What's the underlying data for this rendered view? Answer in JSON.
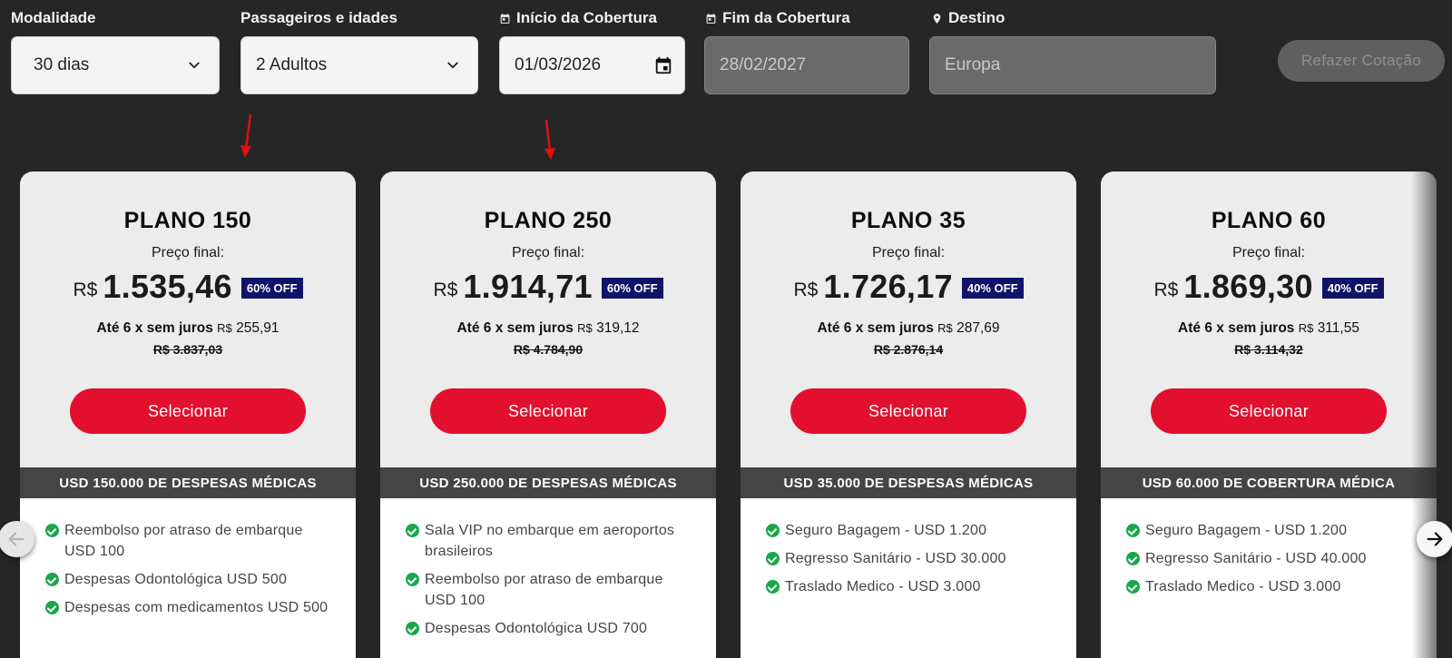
{
  "filters": {
    "modalidade": {
      "label": "Modalidade",
      "value": "30 dias"
    },
    "passageiros": {
      "label": "Passageiros e idades",
      "value": "2 Adultos"
    },
    "inicio": {
      "label": "Início da Cobertura",
      "value": "01/03/2026"
    },
    "fim": {
      "label": "Fim da Cobertura",
      "value": "28/02/2027"
    },
    "destino": {
      "label": "Destino",
      "value": "Europa"
    },
    "requote_label": "Refazer Cotação"
  },
  "plans": [
    {
      "title": "PLANO 150",
      "price_label": "Preço final:",
      "currency": "R$",
      "amount": "1.535,46",
      "discount": "60% OFF",
      "installments_prefix": "Até",
      "installments_count": "6",
      "installments_mid": "x sem juros",
      "installment_currency": "R$",
      "installment_value": "255,91",
      "old_price": "R$ 3.837,03",
      "select_label": "Selecionar",
      "coverage": "USD 150.000 DE DESPESAS MÉDICAS",
      "benefits": [
        "Reembolso por atraso de embarque USD 100",
        "Despesas Odontológica USD 500",
        "Despesas com medicamentos USD 500"
      ]
    },
    {
      "title": "PLANO 250",
      "price_label": "Preço final:",
      "currency": "R$",
      "amount": "1.914,71",
      "discount": "60% OFF",
      "installments_prefix": "Até",
      "installments_count": "6",
      "installments_mid": "x sem juros",
      "installment_currency": "R$",
      "installment_value": "319,12",
      "old_price": "R$ 4.784,90",
      "select_label": "Selecionar",
      "coverage": "USD 250.000 DE DESPESAS MÉDICAS",
      "benefits": [
        "Sala VIP no embarque em aeroportos brasileiros",
        "Reembolso por atraso de embarque USD 100",
        "Despesas Odontológica USD 700"
      ]
    },
    {
      "title": "PLANO 35",
      "price_label": "Preço final:",
      "currency": "R$",
      "amount": "1.726,17",
      "discount": "40% OFF",
      "installments_prefix": "Até",
      "installments_count": "6",
      "installments_mid": "x sem juros",
      "installment_currency": "R$",
      "installment_value": "287,69",
      "old_price": "R$ 2.876,14",
      "select_label": "Selecionar",
      "coverage": "USD 35.000 DE DESPESAS MÉDICAS",
      "benefits": [
        "Seguro Bagagem - USD 1.200",
        "Regresso Sanitário - USD 30.000",
        "Traslado Medico - USD 3.000"
      ]
    },
    {
      "title": "PLANO 60",
      "price_label": "Preço final:",
      "currency": "R$",
      "amount": "1.869,30",
      "discount": "40% OFF",
      "installments_prefix": "Até",
      "installments_count": "6",
      "installments_mid": "x sem juros",
      "installment_currency": "R$",
      "installment_value": "311,55",
      "old_price": "R$ 3.114,32",
      "select_label": "Selecionar",
      "coverage": "USD 60.000 DE COBERTURA MÉDICA",
      "benefits": [
        "Seguro Bagagem - USD 1.200",
        "Regresso Sanitário - USD 40.000",
        "Traslado Medico - USD 3.000"
      ]
    }
  ],
  "colors": {
    "page_bg": "#262626",
    "select_button": "#e30f2f",
    "discount_badge": "#0f1468",
    "check_icon": "#1aa64a",
    "annotation_arrow": "#e01010"
  },
  "icons": {
    "calendar": "calendar-icon",
    "location": "location-pin-icon",
    "chevron": "chevron-down-icon",
    "check": "check-circle-icon",
    "prev": "arrow-left-icon",
    "next": "arrow-right-icon"
  }
}
